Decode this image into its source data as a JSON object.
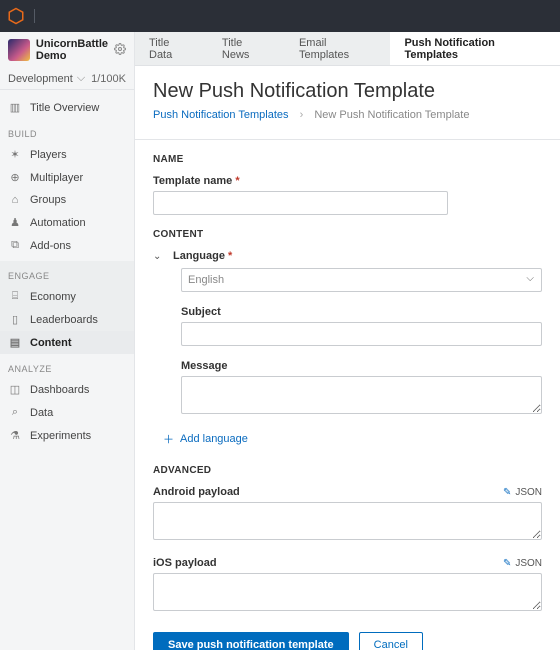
{
  "app": {
    "studio_name": "UnicornBattle Demo",
    "environment": "Development",
    "quota": "1/100K"
  },
  "sidebar": {
    "overview": "Title Overview",
    "sections": {
      "build": {
        "label": "BUILD",
        "items": [
          "Players",
          "Multiplayer",
          "Groups",
          "Automation",
          "Add-ons"
        ]
      },
      "engage": {
        "label": "ENGAGE",
        "items": [
          "Economy",
          "Leaderboards",
          "Content"
        ]
      },
      "analyze": {
        "label": "ANALYZE",
        "items": [
          "Dashboards",
          "Data",
          "Experiments"
        ]
      }
    }
  },
  "tabs": [
    "Title Data",
    "Title News",
    "Email Templates",
    "Push Notification Templates"
  ],
  "breadcrumb": {
    "parent": "Push Notification Templates",
    "current": "New Push Notification Template"
  },
  "page_title": "New Push Notification Template",
  "sections": {
    "name": {
      "label": "NAME",
      "template_name_label": "Template name"
    },
    "content": {
      "label": "CONTENT",
      "language_label": "Language",
      "language_value": "English",
      "subject_label": "Subject",
      "message_label": "Message",
      "add_language": "Add language"
    },
    "advanced": {
      "label": "ADVANCED",
      "android_label": "Android payload",
      "ios_label": "iOS payload",
      "json_badge": "JSON"
    }
  },
  "buttons": {
    "save": "Save push notification template",
    "cancel": "Cancel"
  }
}
